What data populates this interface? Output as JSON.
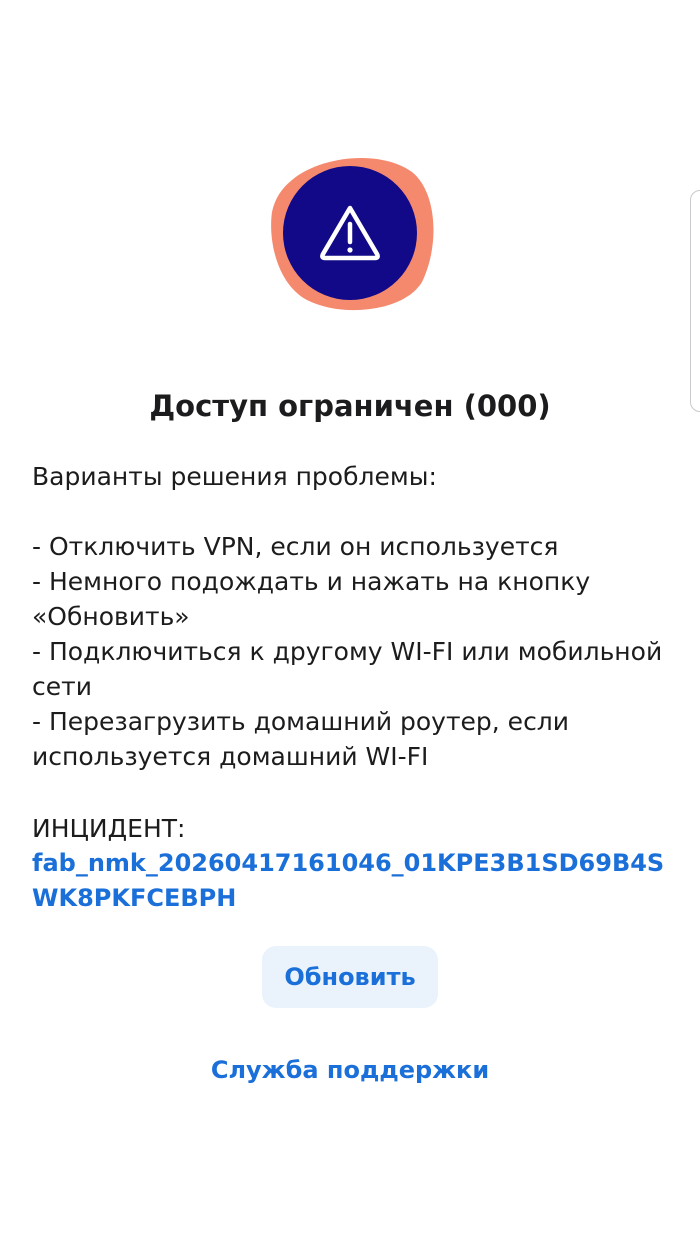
{
  "colors": {
    "accent": "#1a6fd9",
    "button_bg": "#eaf3fc",
    "icon_circle": "#110987",
    "icon_blob_coral": "#f4896e",
    "icon_blob_yellow": "#f6dc6a"
  },
  "illustration": {
    "icon": "warning-triangle-icon"
  },
  "title": "Доступ ограничен (000)",
  "solutions": {
    "heading": "Варианты решения проблемы:",
    "items": [
      "- Отключить VPN, если он используется",
      "- Немного подождать и нажать на кнопку «Обновить»",
      "- Подключиться к другому WI-FI или мобильной сети",
      "- Перезагрузить домашний роутер, если используется домашний WI-FI"
    ]
  },
  "incident": {
    "label": "ИНЦИДЕНТ:",
    "code": "fab_nmk_20260417161046_01KPE3B1SD69B4SWK8PKFCEBPH"
  },
  "actions": {
    "refresh_label": "Обновить",
    "support_label": "Служба поддержки"
  }
}
